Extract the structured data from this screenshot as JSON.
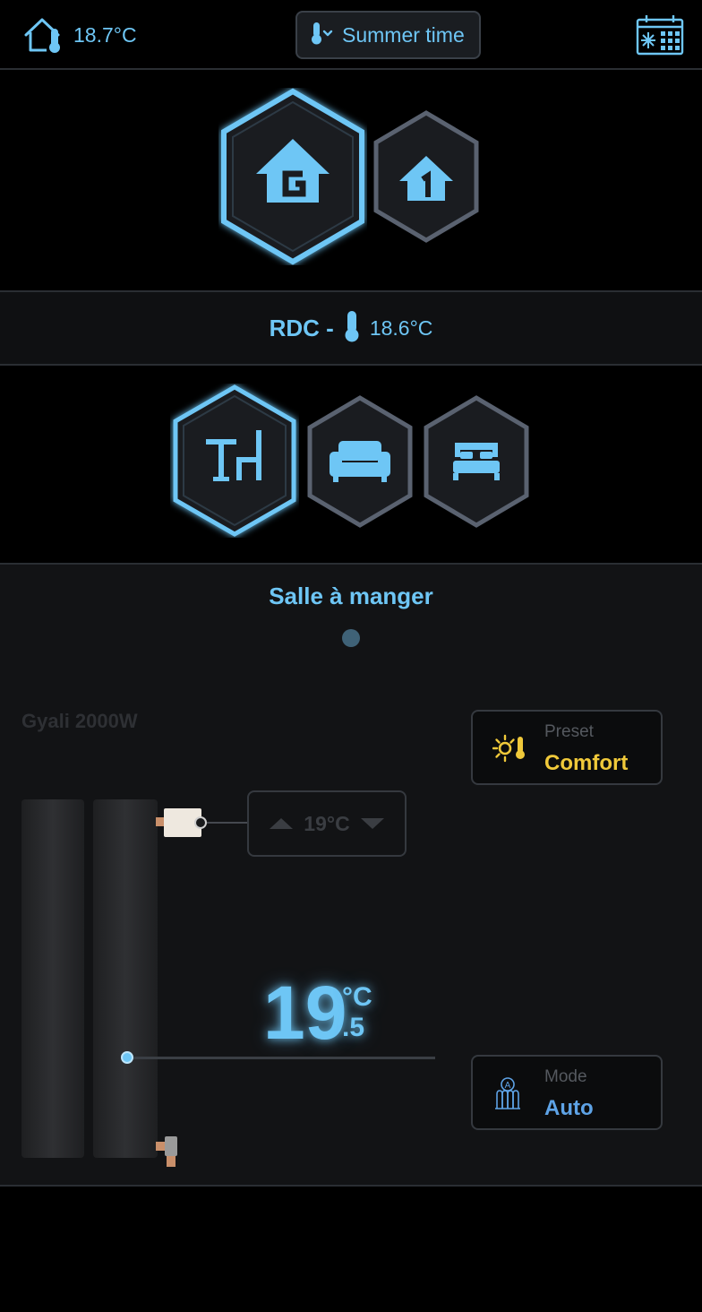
{
  "header": {
    "home_temp": "18.7°C",
    "season_label": "Summer time"
  },
  "floors": [
    {
      "name": "G",
      "active": true
    },
    {
      "name": "1",
      "active": false
    }
  ],
  "floor_info": {
    "name": "RDC -",
    "temp": "18.6°C"
  },
  "rooms": [
    {
      "icon": "dining-table-icon",
      "active": true
    },
    {
      "icon": "sofa-icon",
      "active": false
    },
    {
      "icon": "bed-icon",
      "active": false
    }
  ],
  "room": {
    "title": "Salle à manger",
    "device_name": "Gyali 2000W",
    "preset": {
      "caption": "Preset",
      "value": "Comfort"
    },
    "mode": {
      "caption": "Mode",
      "value": "Auto"
    },
    "setpoint": "19°C",
    "current_temp": {
      "int": "19",
      "dec": ".5",
      "unit": "°C"
    }
  },
  "colors": {
    "accent": "#6ec6f5",
    "preset_value": "#f0c93a",
    "mode_value": "#5ea3e6",
    "inactive_hex_border": "#5a6270"
  }
}
